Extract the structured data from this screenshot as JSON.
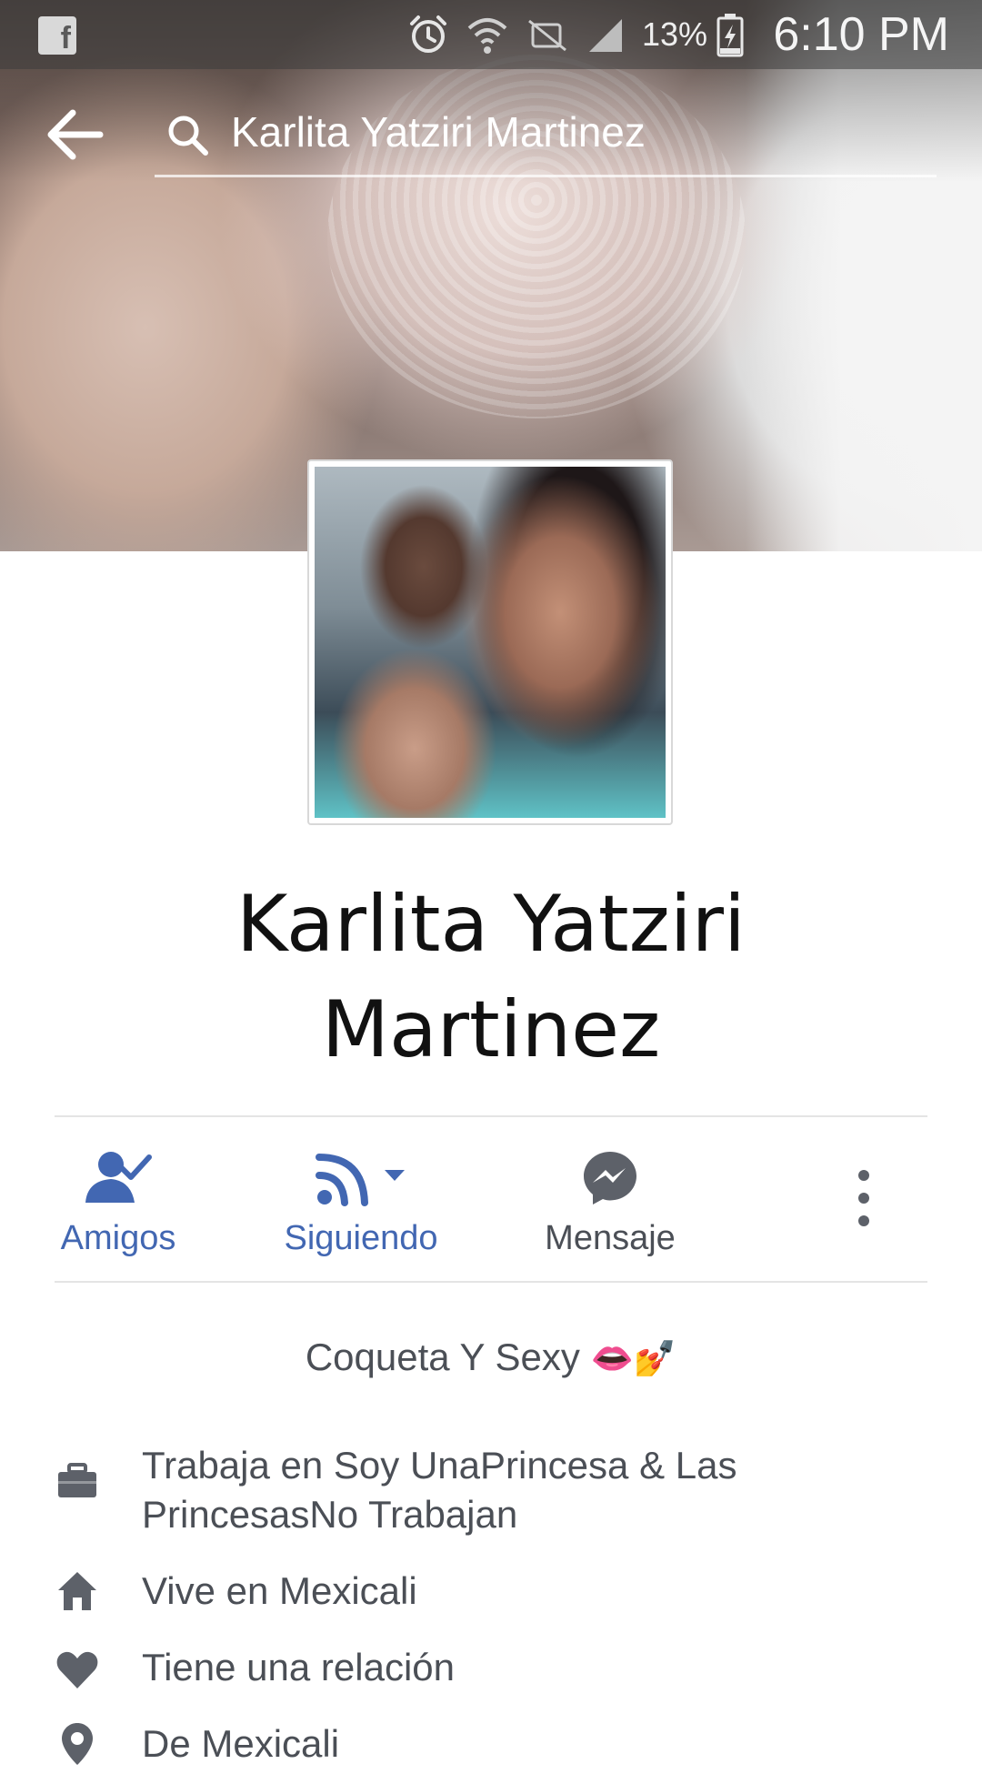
{
  "status_bar": {
    "app_icon": "facebook-icon",
    "icons": [
      "alarm-icon",
      "wifi-icon",
      "no-sim-icon",
      "signal-icon"
    ],
    "battery_percent": "13%",
    "battery_icon": "battery-charging-icon",
    "time": "6:10 PM"
  },
  "header": {
    "back_icon": "arrow-left-icon",
    "search_icon": "search-icon",
    "search_value": "Karlita Yatziri Martinez"
  },
  "profile": {
    "name_line1": "Karlita Yatziri",
    "name_line2": "Martinez"
  },
  "actions": [
    {
      "label": "Amigos",
      "icon": "friends-check-icon",
      "color": "#4267b2"
    },
    {
      "label": "Siguiendo",
      "icon": "rss-following-icon",
      "color": "#4267b2"
    },
    {
      "label": "Mensaje",
      "icon": "messenger-icon",
      "color": "#4b4f56"
    },
    {
      "label": "",
      "icon": "more-vertical-icon",
      "color": "#4b4f56"
    }
  ],
  "bio": {
    "text": "Coqueta Y Sexy",
    "emoji": "👄💅"
  },
  "details": [
    {
      "icon": "briefcase-icon",
      "text_line1": "Trabaja en Soy UnaPrincesa & Las",
      "text_line2": "PrincesasNo Trabajan"
    },
    {
      "icon": "home-icon",
      "text_line1": "Vive en Mexicali"
    },
    {
      "icon": "heart-icon",
      "text_line1": "Tiene una relación"
    },
    {
      "icon": "location-pin-icon",
      "text_line1": "De Mexicali"
    }
  ],
  "colors": {
    "accent_blue": "#4267b2",
    "text_gray": "#4b4f56",
    "icon_gray": "#5d6169"
  }
}
